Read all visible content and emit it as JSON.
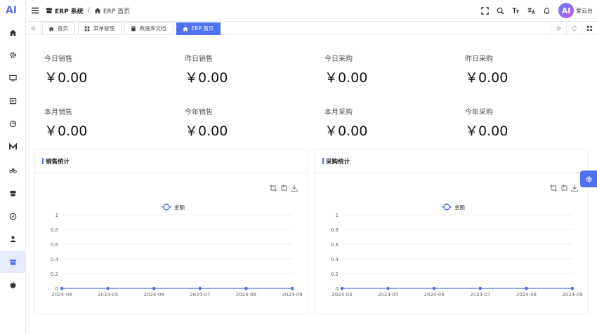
{
  "header": {
    "logo_text": "AI",
    "breadcrumb": [
      "ERP 系统",
      "ERP 首页"
    ],
    "user": {
      "avatar_text": "AI",
      "name": "爱云台"
    }
  },
  "tabs": [
    {
      "label": "首页",
      "icon": "home-icon",
      "active": false
    },
    {
      "label": "菜单管理",
      "icon": "grid-icon",
      "active": false
    },
    {
      "label": "数据库文档",
      "icon": "book-icon",
      "active": false
    },
    {
      "label": "ERP 首页",
      "icon": "home-icon",
      "active": true
    }
  ],
  "stats": [
    {
      "label": "今日销售",
      "value": "￥0.00"
    },
    {
      "label": "昨日销售",
      "value": "￥0.00"
    },
    {
      "label": "今日采购",
      "value": "￥0.00"
    },
    {
      "label": "昨日采购",
      "value": "￥0.00"
    },
    {
      "label": "本月销售",
      "value": "￥0.00"
    },
    {
      "label": "今年销售",
      "value": "￥0.00"
    },
    {
      "label": "本月采购",
      "value": "￥0.00"
    },
    {
      "label": "今年采购",
      "value": "￥0.00"
    }
  ],
  "colors": {
    "accent": "#4e71f0",
    "line": "#4e71f0"
  },
  "chart_data": [
    {
      "type": "line",
      "title": "销售统计",
      "legend_position": "top-center",
      "categories": [
        "2024-04",
        "2024-05",
        "2024-06",
        "2024-07",
        "2024-08",
        "2024-09"
      ],
      "yticks": [
        "0",
        "0.2",
        "0.4",
        "0.6",
        "0.8",
        "1"
      ],
      "ylim": [
        0,
        1
      ],
      "grid": true,
      "series": [
        {
          "name": "金额",
          "values": [
            0,
            0,
            0,
            0,
            0,
            0
          ]
        }
      ]
    },
    {
      "type": "line",
      "title": "采购统计",
      "legend_position": "top-center",
      "categories": [
        "2024-04",
        "2024-05",
        "2024-06",
        "2024-07",
        "2024-08",
        "2024-09"
      ],
      "yticks": [
        "0",
        "0.2",
        "0.4",
        "0.6",
        "0.8",
        "1"
      ],
      "ylim": [
        0,
        1
      ],
      "grid": true,
      "series": [
        {
          "name": "金额",
          "values": [
            0,
            0,
            0,
            0,
            0,
            0
          ]
        }
      ]
    }
  ]
}
